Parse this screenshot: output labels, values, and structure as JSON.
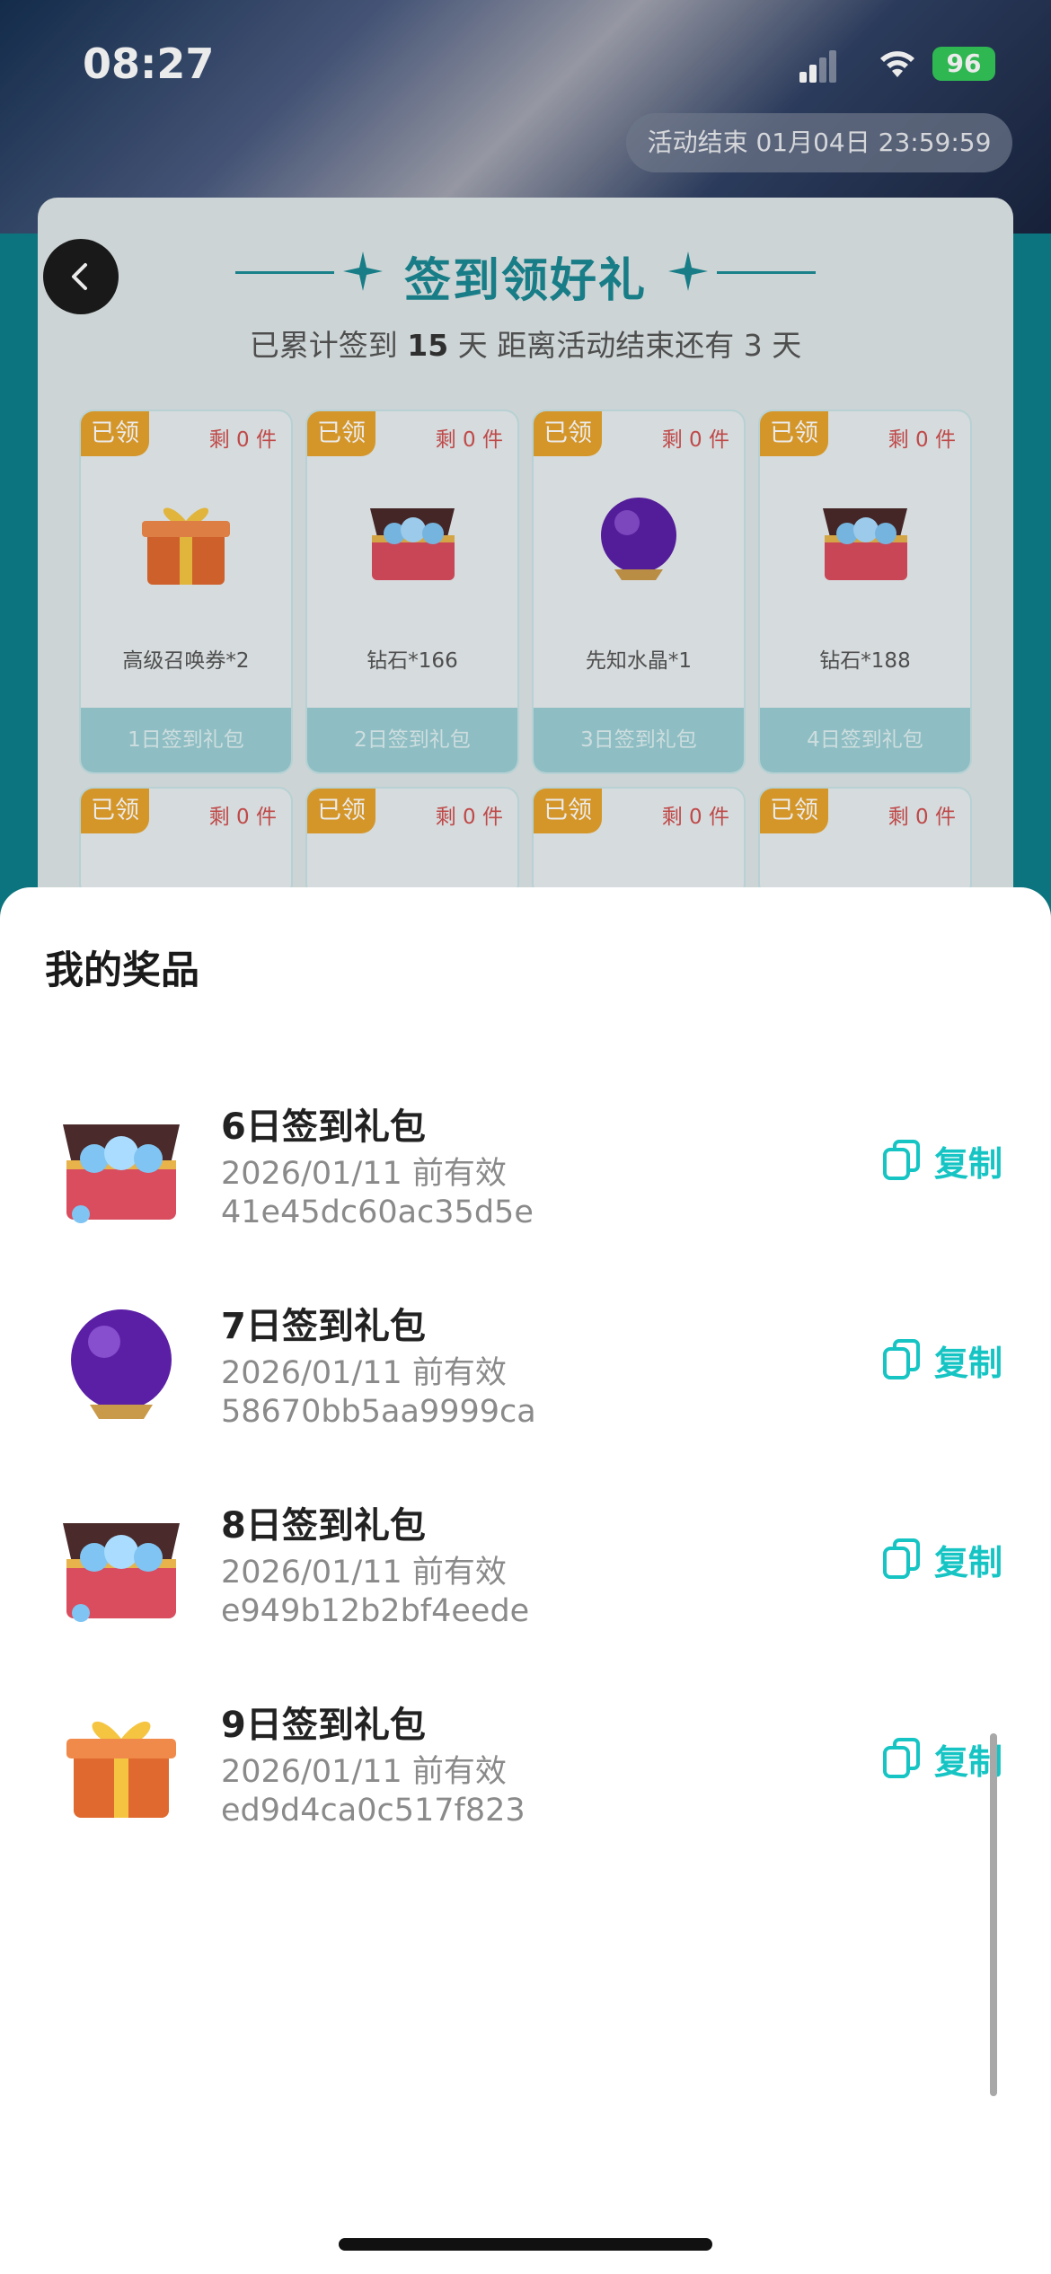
{
  "status_bar": {
    "time": "08:27",
    "battery": "96"
  },
  "activity": {
    "countdown": "活动结束 01月04日 23:59:59",
    "title": "签到领好礼",
    "subtitle_prefix": "已累计签到",
    "signed_days": "15",
    "subtitle_mid": "天  距离活动结束还有",
    "remaining_days": "3",
    "subtitle_suffix": "天"
  },
  "cards": [
    {
      "badge": "已领",
      "remain": "剩 0 件",
      "name": "高级召唤券*2",
      "footer": "1日签到礼包",
      "icon": "gift-box-icon"
    },
    {
      "badge": "已领",
      "remain": "剩 0 件",
      "name": "钻石*166",
      "footer": "2日签到礼包",
      "icon": "diamond-chest-icon"
    },
    {
      "badge": "已领",
      "remain": "剩 0 件",
      "name": "先知水晶*1",
      "footer": "3日签到礼包",
      "icon": "crystal-orb-icon"
    },
    {
      "badge": "已领",
      "remain": "剩 0 件",
      "name": "钻石*188",
      "footer": "4日签到礼包",
      "icon": "diamond-chest-icon"
    },
    {
      "badge": "已领",
      "remain": "剩 0 件"
    },
    {
      "badge": "已领",
      "remain": "剩 0 件"
    },
    {
      "badge": "已领",
      "remain": "剩 0 件"
    },
    {
      "badge": "已领",
      "remain": "剩 0 件"
    }
  ],
  "sheet": {
    "title": "我的奖品",
    "copy_label": "复制",
    "prizes": [
      {
        "name": "6日签到礼包",
        "valid": "2026/01/11 前有效",
        "code": "41e45dc60ac35d5e",
        "icon": "diamond-chest-icon"
      },
      {
        "name": "7日签到礼包",
        "valid": "2026/01/11 前有效",
        "code": "58670bb5aa9999ca",
        "icon": "crystal-orb-icon"
      },
      {
        "name": "8日签到礼包",
        "valid": "2026/01/11 前有效",
        "code": "e949b12b2bf4eede",
        "icon": "diamond-chest-icon"
      },
      {
        "name": "9日签到礼包",
        "valid": "2026/01/11 前有效",
        "code": "ed9d4ca0c517f823",
        "icon": "gift-box-icon"
      }
    ]
  },
  "colors": {
    "accent": "#17c4c4",
    "title_teal": "#1b8893",
    "badge": "#e7a32d"
  }
}
